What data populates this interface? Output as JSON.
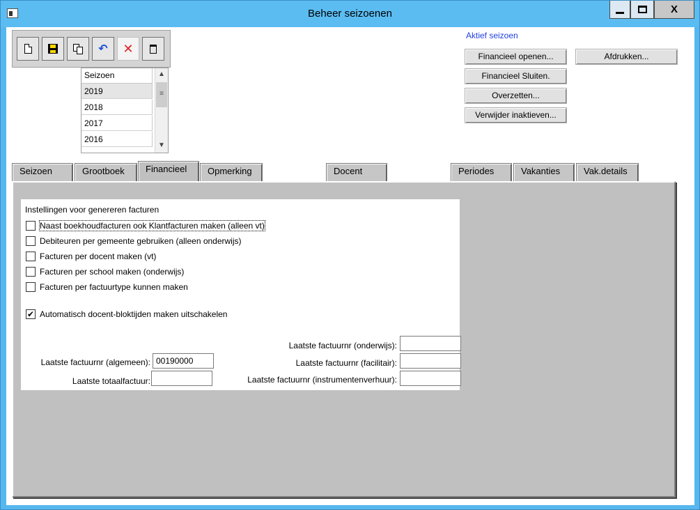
{
  "window": {
    "title": "Beheer seizoenen",
    "close_glyph": "X"
  },
  "toolbar": {
    "buttons": [
      "new-icon",
      "save-icon",
      "copy-icon",
      "undo-icon",
      "cancel-icon",
      "delete-icon"
    ]
  },
  "season_list": {
    "header": "Seizoen",
    "rows": [
      "2019",
      "2018",
      "2017",
      "2016"
    ],
    "selected": "2019"
  },
  "actions": {
    "active_label": "Aktief seizoen",
    "open_financial": "Financieel openen...",
    "close_financial": "Financieel Sluiten.",
    "transfer": "Overzetten...",
    "remove_inactive": "Verwijder inaktieven...",
    "print": "Afdrukken..."
  },
  "tabs": [
    "Seizoen",
    "Grootboek",
    "Financieel",
    "Opmerking",
    "Docent",
    "Periodes",
    "Vakanties",
    "Vak.details"
  ],
  "active_tab": "Financieel",
  "financieel": {
    "section_title": "Instellingen voor genereren facturen",
    "checkboxes": [
      {
        "label": "Naast boekhoudfacturen ook Klantfacturen maken (alleen vt)",
        "checked": false
      },
      {
        "label": "Debiteuren per gemeente gebruiken (alleen onderwijs)",
        "checked": false
      },
      {
        "label": "Facturen per docent maken (vt)",
        "checked": false
      },
      {
        "label": "Facturen per school maken (onderwijs)",
        "checked": false
      },
      {
        "label": "Facturen per factuurtype kunnen maken",
        "checked": false
      },
      {
        "label": "Automatisch docent-bloktijden maken uitschakelen",
        "checked": true
      }
    ],
    "fields": {
      "algemeen_label": "Laatste factuurnr (algemeen):",
      "algemeen_value": "00190000",
      "totaal_label": "Laatste totaalfactuur:",
      "totaal_value": "",
      "onderwijs_label": "Laatste factuurnr (onderwijs):",
      "onderwijs_value": "",
      "facilitair_label": "Laatste factuurnr (facilitair):",
      "facilitair_value": "",
      "instrumenten_label": "Laatste factuurnr (instrumentenverhuur):",
      "instrumenten_value": ""
    }
  }
}
